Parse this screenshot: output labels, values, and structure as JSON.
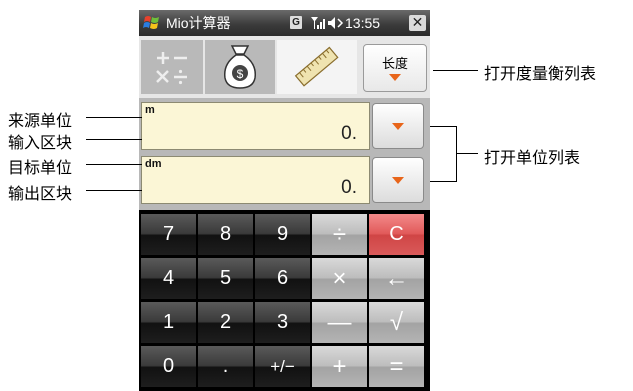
{
  "statusbar": {
    "app_title": "Mio计算器",
    "network_badge": "G",
    "clock": "13:55",
    "close_label": "✕"
  },
  "tabs": {
    "unit_list_button_label": "长度"
  },
  "source": {
    "unit": "m",
    "value": "0."
  },
  "target": {
    "unit": "dm",
    "value": "0."
  },
  "keypad": {
    "rows": [
      [
        "7",
        "8",
        "9",
        "÷",
        "C"
      ],
      [
        "4",
        "5",
        "6",
        "×",
        "←"
      ],
      [
        "1",
        "2",
        "3",
        "—",
        "√"
      ],
      [
        "0",
        ".",
        "+/−",
        "+",
        "="
      ]
    ]
  },
  "annotations": {
    "open_measure_list": "打开度量衡列表",
    "source_unit": "来源单位",
    "input_block": "输入区块",
    "target_unit": "目标单位",
    "output_block": "输出区块",
    "open_unit_list": "打开单位列表"
  },
  "colors": {
    "field_bg": "#fbf6d6",
    "accent_orange": "#e8651a",
    "clear_key": "#e15a5a"
  },
  "icons": {
    "app_logo": "windows-flag-icon",
    "signal": "signal-icon",
    "speaker": "speaker-icon",
    "basic_tab": "plus-minus-times-divide-icon",
    "money_tab": "money-bag-icon",
    "unit_tab": "ruler-icon"
  }
}
